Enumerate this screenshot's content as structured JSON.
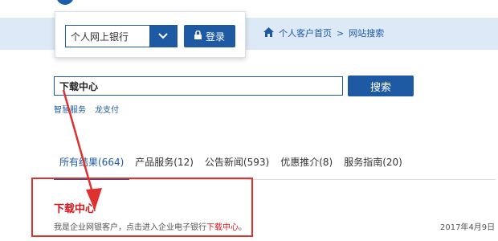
{
  "header": {
    "bank_select": {
      "value": "个人网上银行",
      "icon": "chevron-down-icon"
    },
    "login_button": {
      "label": "登录",
      "icon": "lock-icon"
    },
    "breadcrumb": {
      "home": "个人客户首页",
      "separator": ">",
      "current": "网站搜索",
      "icon": "home-icon"
    }
  },
  "search": {
    "query": "下载中心",
    "button_label": "搜索",
    "quick_links": [
      "智慧服务",
      "龙支付"
    ]
  },
  "tabs": [
    {
      "label": "所有结果(664)",
      "active": true
    },
    {
      "label": "产品服务(12)",
      "active": false
    },
    {
      "label": "公告新闻(593)",
      "active": false
    },
    {
      "label": "优惠推介(8)",
      "active": false
    },
    {
      "label": "服务指南(20)",
      "active": false
    }
  ],
  "result": {
    "title": "下载中心",
    "desc_prefix": "我是企业网银客户，点击进入企业电子银行",
    "desc_highlight": "下载中心",
    "desc_suffix": "。",
    "date": "2017年4月9日"
  },
  "colors": {
    "brand_blue": "#1e5aa3",
    "nav_band": "#dde9f6",
    "annotation_red": "#e03131"
  }
}
